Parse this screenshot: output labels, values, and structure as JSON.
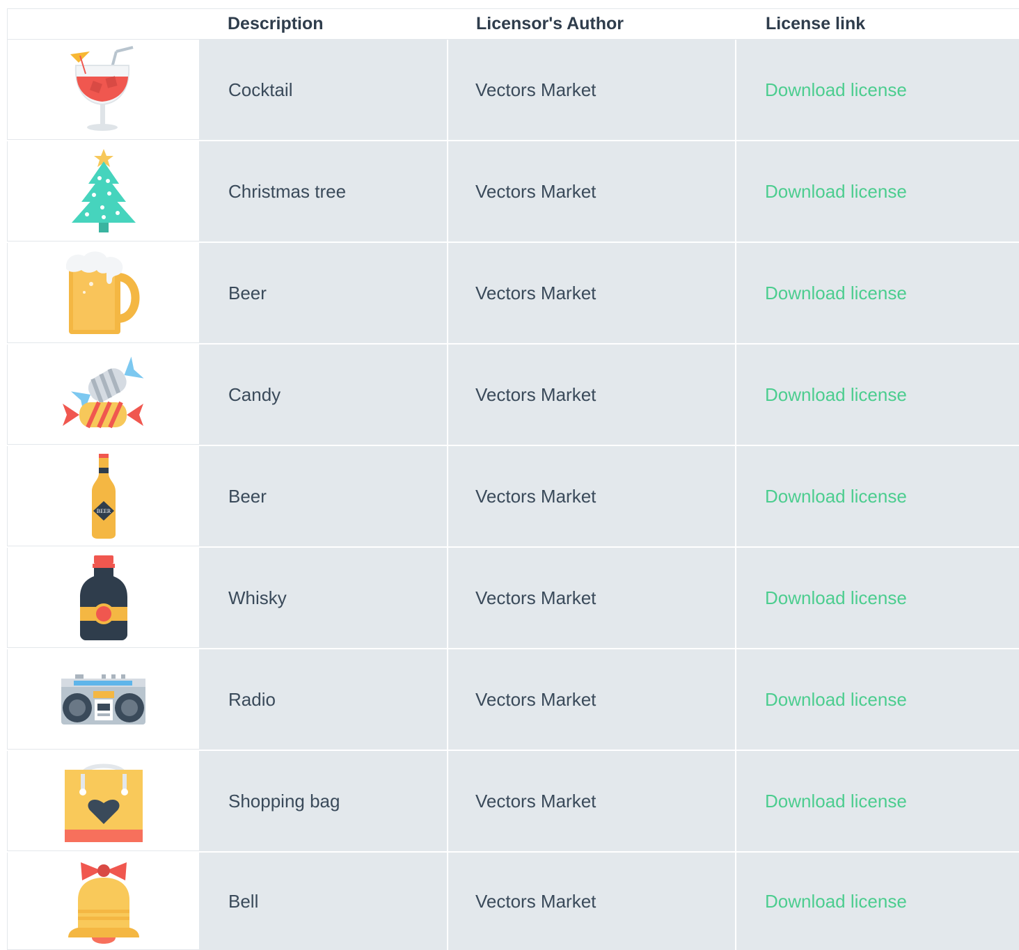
{
  "header": {
    "description": "Description",
    "author": "Licensor's Author",
    "link": "License link"
  },
  "rows": [
    {
      "icon": "cocktail-icon",
      "description": "Cocktail",
      "author": "Vectors Market",
      "link": "Download license"
    },
    {
      "icon": "christmas-tree-icon",
      "description": "Christmas tree",
      "author": "Vectors Market",
      "link": "Download license"
    },
    {
      "icon": "beer-mug-icon",
      "description": "Beer",
      "author": "Vectors Market",
      "link": "Download license"
    },
    {
      "icon": "candy-icon",
      "description": "Candy",
      "author": "Vectors Market",
      "link": "Download license"
    },
    {
      "icon": "beer-bottle-icon",
      "description": "Beer",
      "author": "Vectors Market",
      "link": "Download license",
      "icon_label": "BEER"
    },
    {
      "icon": "whisky-icon",
      "description": "Whisky",
      "author": "Vectors Market",
      "link": "Download license"
    },
    {
      "icon": "radio-icon",
      "description": "Radio",
      "author": "Vectors Market",
      "link": "Download license"
    },
    {
      "icon": "shopping-bag-icon",
      "description": "Shopping bag",
      "author": "Vectors Market",
      "link": "Download license"
    },
    {
      "icon": "bell-icon",
      "description": "Bell",
      "author": "Vectors Market",
      "link": "Download license"
    }
  ],
  "colors": {
    "link": "#4ccd8f",
    "cell_bg": "#e3e8ec",
    "text": "#3a4a5a",
    "header_text": "#2f3d4c"
  }
}
